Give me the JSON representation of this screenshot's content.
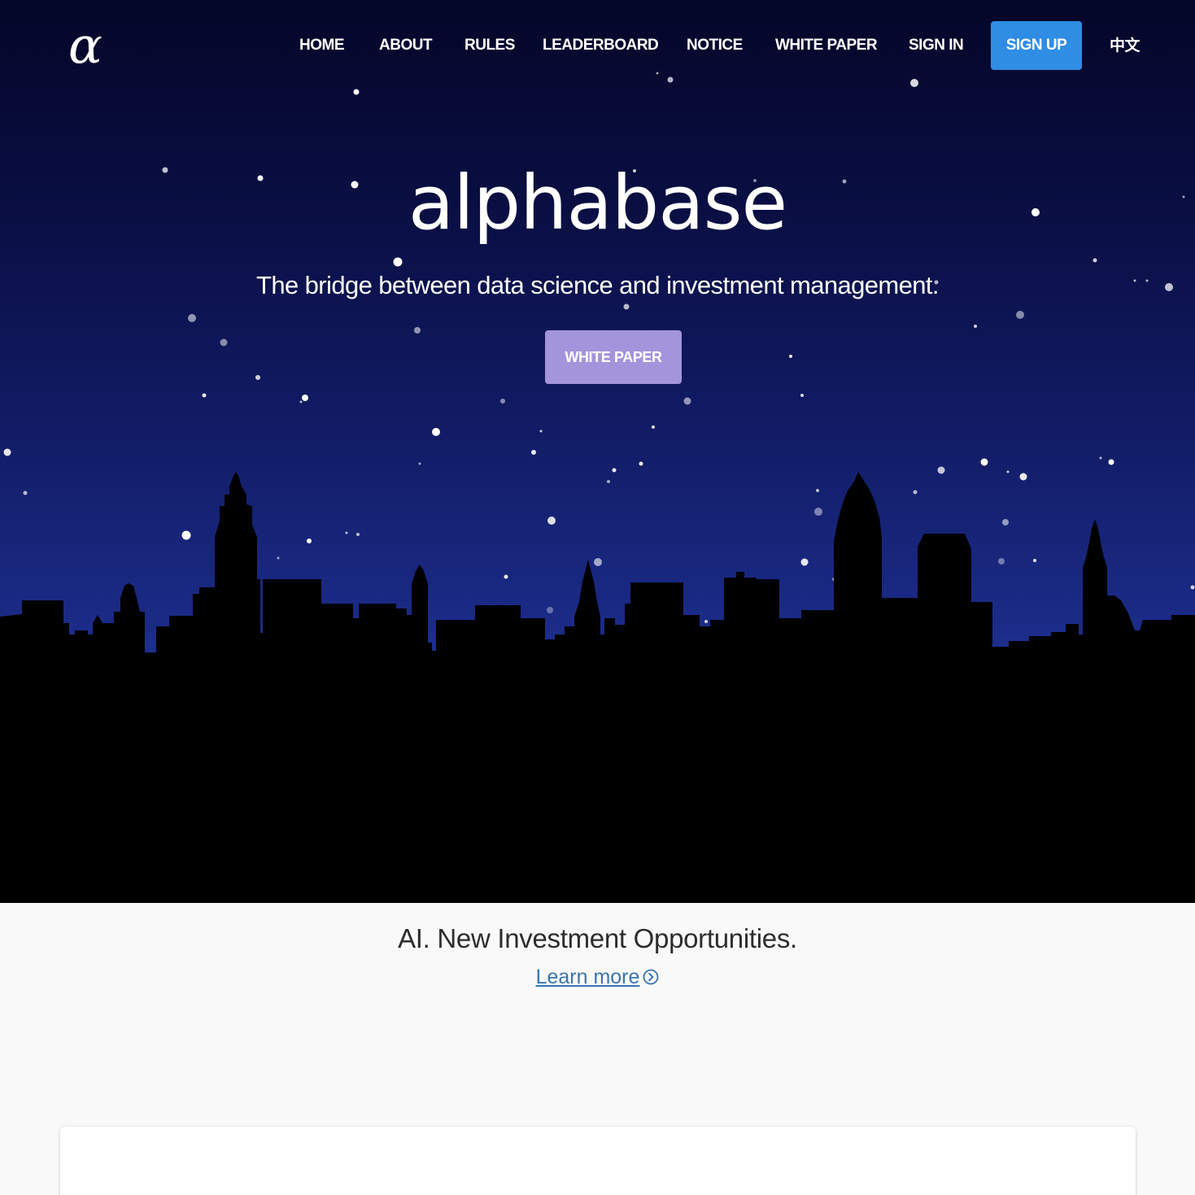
{
  "logo": {
    "glyph": "α",
    "icon": "alpha-logo-icon"
  },
  "nav": {
    "items": [
      {
        "label": "HOME"
      },
      {
        "label": "ABOUT"
      },
      {
        "label": "RULES"
      },
      {
        "label": "LEADERBOARD"
      },
      {
        "label": "NOTICE"
      },
      {
        "label": "WHITE PAPER"
      },
      {
        "label": "SIGN IN"
      }
    ],
    "signup_label": "SIGN UP",
    "language_label": "中文"
  },
  "hero": {
    "title": "alphabase",
    "subtitle": "The bridge between data science and investment management.",
    "button_label": "WHITE PAPER"
  },
  "section": {
    "tagline": "AI. New Investment Opportunities.",
    "learn_more_label": "Learn more",
    "learn_more_icon": "chevron-right-circle-icon"
  },
  "colors": {
    "signup_button": "#2f8de4",
    "hero_button": "#a394dc",
    "link": "#3a74ad",
    "sky_top": "#040628",
    "sky_bottom": "#22379a"
  }
}
